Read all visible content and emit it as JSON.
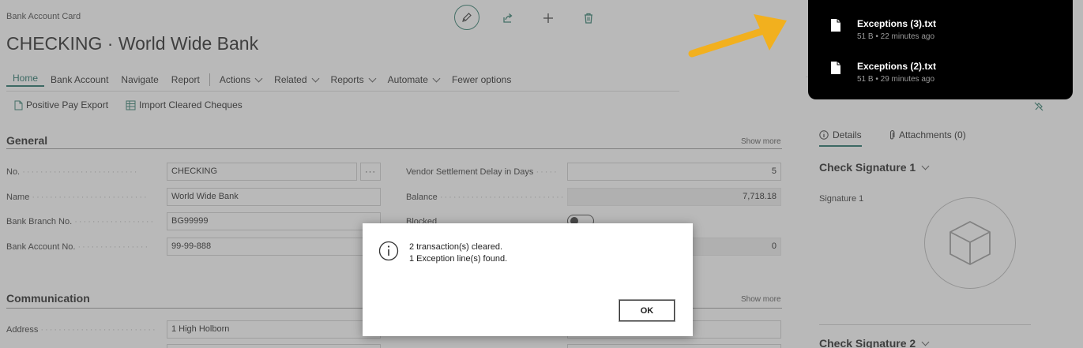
{
  "header": {
    "card_type": "Bank Account Card",
    "title": "CHECKING · World Wide Bank"
  },
  "menu": {
    "items": [
      {
        "label": "Home",
        "active": true
      },
      {
        "label": "Bank Account"
      },
      {
        "label": "Navigate"
      },
      {
        "label": "Report"
      },
      {
        "label": "Actions",
        "dropdown": true
      },
      {
        "label": "Related",
        "dropdown": true
      },
      {
        "label": "Reports",
        "dropdown": true
      },
      {
        "label": "Automate",
        "dropdown": true
      },
      {
        "label": "Fewer options"
      }
    ]
  },
  "actions": {
    "positive_pay_export": "Positive Pay Export",
    "import_cleared_cheques": "Import Cleared Cheques"
  },
  "general": {
    "title": "General",
    "show_more": "Show more",
    "fields": {
      "no_label": "No.",
      "no_value": "CHECKING",
      "name_label": "Name",
      "name_value": "World Wide Bank",
      "branch_label": "Bank Branch No.",
      "branch_value": "BG99999",
      "account_label": "Bank Account No.",
      "account_value": "99-99-888",
      "vendor_delay_label": "Vendor Settlement Delay in Days",
      "vendor_delay_value": "5",
      "balance_label": "Balance",
      "balance_value": "7,718.18",
      "blocked_label": "Blocked",
      "hidden_value": "0"
    }
  },
  "communication": {
    "title": "Communication",
    "show_more": "Show more",
    "address_label": "Address",
    "address_value": "1 High Holborn"
  },
  "details_pane": {
    "tab_details": "Details",
    "tab_attachments": "Attachments (0)",
    "check_signature_1": "Check Signature 1",
    "signature_1_label": "Signature 1",
    "check_signature_2": "Check Signature 2"
  },
  "dialog": {
    "line1": "2 transaction(s) cleared.",
    "line2": "1 Exception line(s) found.",
    "ok": "OK"
  },
  "downloads": [
    {
      "name": "Exceptions (3).txt",
      "meta": "51 B • 22 minutes ago"
    },
    {
      "name": "Exceptions (2).txt",
      "meta": "51 B • 29 minutes ago"
    }
  ],
  "colors": {
    "accent": "#1d6e63",
    "arrow": "#f2b01e",
    "downloads_bg": "#000000"
  }
}
